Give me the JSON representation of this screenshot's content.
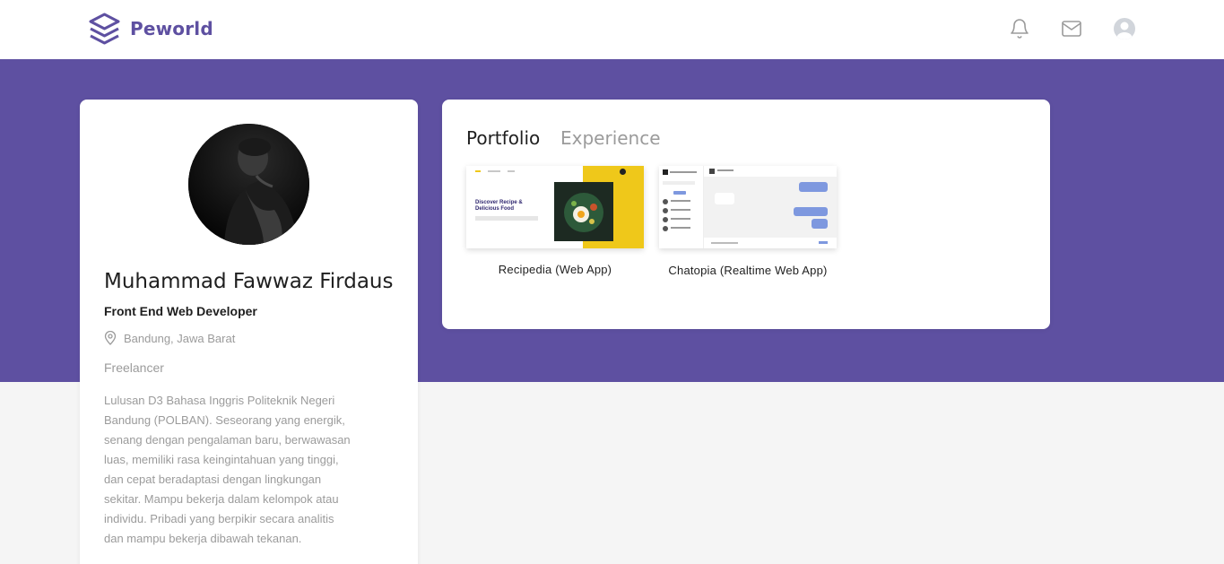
{
  "navbar": {
    "brand": "Peworld",
    "icons": [
      "bell-icon",
      "mail-icon",
      "user-avatar"
    ]
  },
  "profile": {
    "name": "Muhammad Fawwaz Firdaus",
    "role": "Front End Web Developer",
    "location": "Bandung, Jawa Barat",
    "status": "Freelancer",
    "bio": "Lulusan D3 Bahasa Inggris Politeknik Negeri Bandung (POLBAN). Seseorang yang energik, senang dengan pengalaman baru, berwawasan luas, memiliki rasa keingintahuan yang tinggi, dan cepat beradaptasi dengan lingkungan sekitar. Mampu bekerja dalam kelompok atau individu. Pribadi yang berpikir secara analitis dan mampu bekerja dibawah tekanan."
  },
  "tabs": {
    "portfolio": "Portfolio",
    "experience": "Experience",
    "active": "Portfolio"
  },
  "works": [
    {
      "title": "Recipedia (Web App)",
      "thumb_headline": "Discover Recipe & Delicious Food"
    },
    {
      "title": "Chatopia (Realtime Web App)"
    }
  ],
  "colors": {
    "brand": "#5e50a1",
    "accent_yellow": "#efc81a",
    "chat_blue": "#7e98df"
  }
}
